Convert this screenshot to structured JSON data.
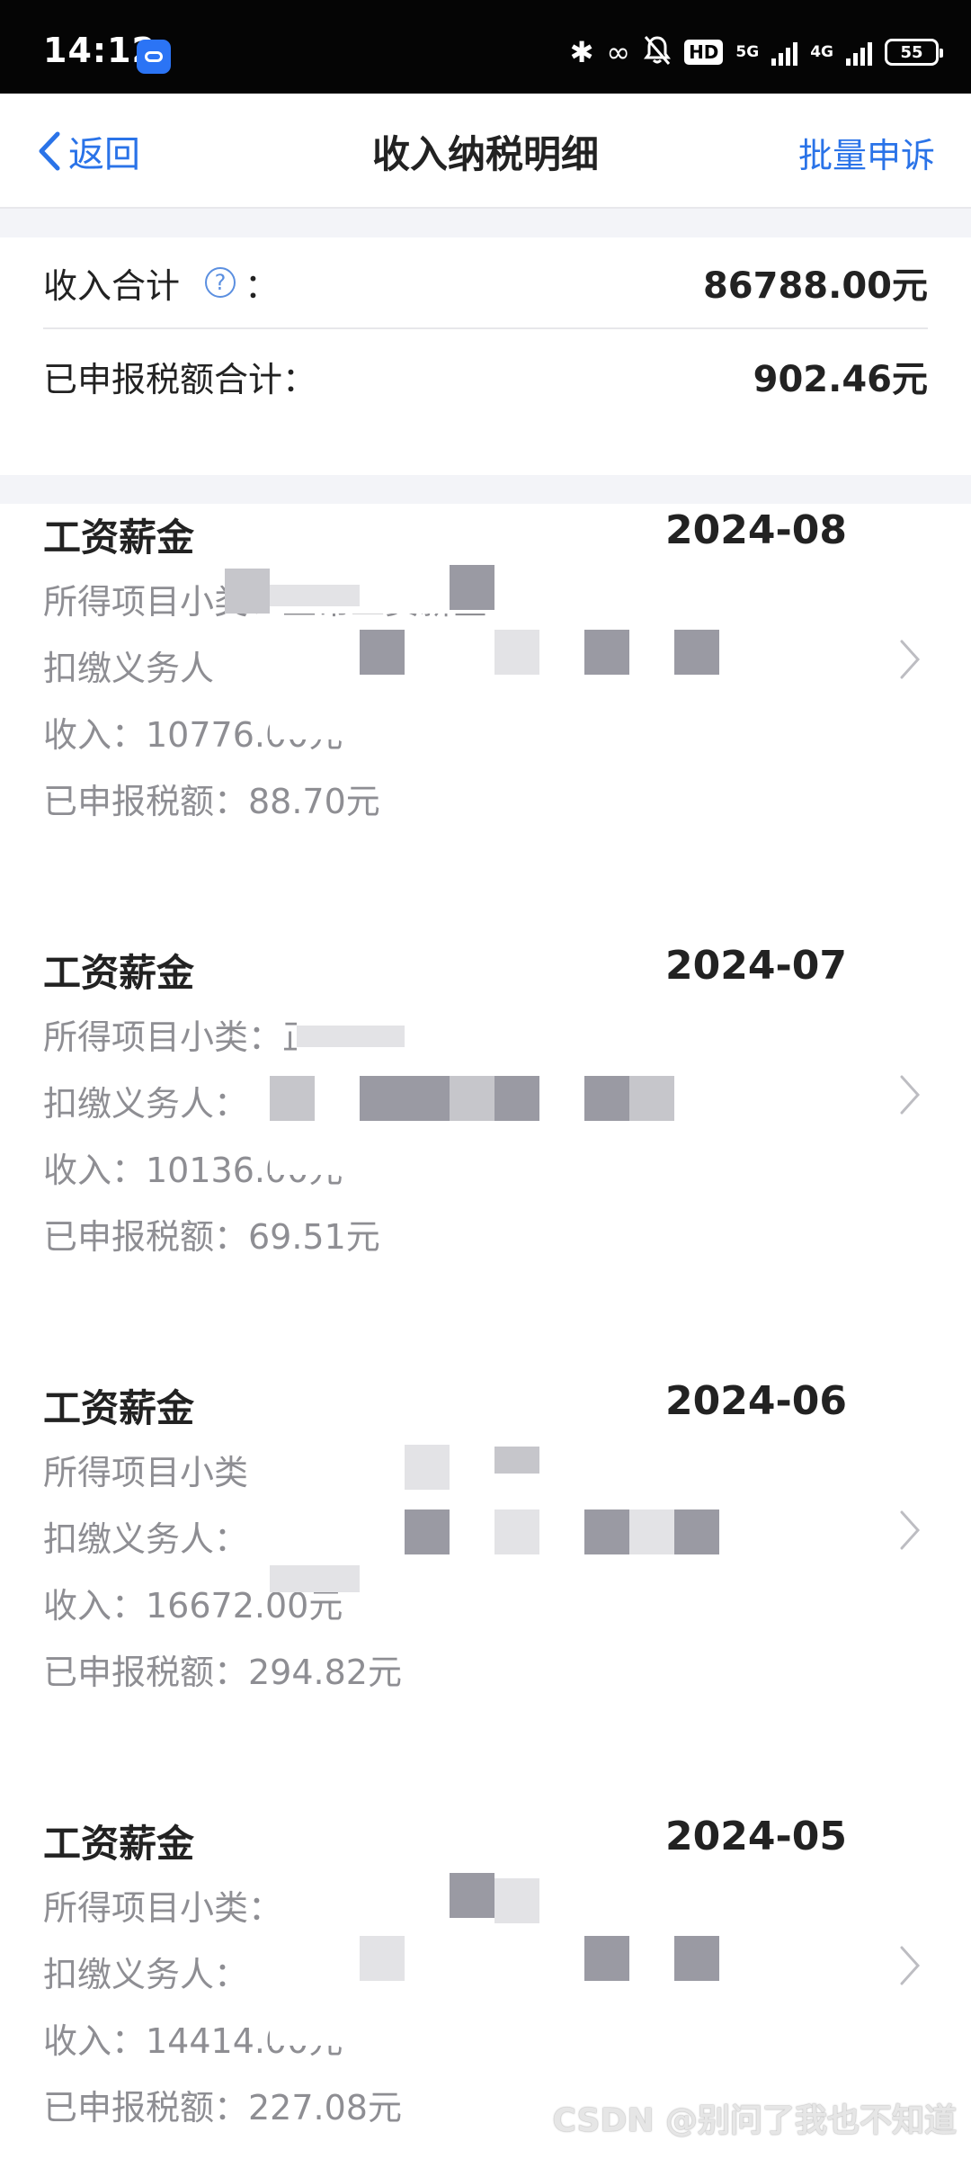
{
  "status_bar": {
    "time": "14:12",
    "hd_label": "HD",
    "network_5g": "5G",
    "network_4g": "4G",
    "battery": "55"
  },
  "nav": {
    "back_label": "返回",
    "title": "收入纳税明细",
    "action_label": "批量申诉"
  },
  "summary": {
    "income_label": "收入合计",
    "income_colon": "：",
    "income_value": "86788.00元",
    "tax_label": "已申报税额合计：",
    "tax_value": "902.46元"
  },
  "records": [
    {
      "title": "工资薪金",
      "date": "2024-08",
      "subcategory": "所得项目小类：正常工资薪金",
      "withholder": "扣缴义务人",
      "income": "收入：10776.00元",
      "tax": "已申报税额：88.70元"
    },
    {
      "title": "工资薪金",
      "date": "2024-07",
      "subcategory": "所得项目小类：正常工资薪金",
      "withholder": "扣缴义务人：",
      "income": "收入：10136.00元",
      "tax": "已申报税额：69.51元"
    },
    {
      "title": "工资薪金",
      "date": "2024-06",
      "subcategory": "所得项目小类",
      "withholder": "扣缴义务人：",
      "income": "收入：16672.00元",
      "tax": "已申报税额：294.82元"
    },
    {
      "title": "工资薪金",
      "date": "2024-05",
      "subcategory": "所得项目小类：",
      "withholder": "扣缴义务人：",
      "income": "收入：14414.00元",
      "tax": "已申报税额：227.08元"
    }
  ],
  "watermark": "CSDN @别问了我也不知道",
  "colors": {
    "accent": "#2a73e8",
    "secondary_text": "#8e8e93",
    "separator_bg": "#f3f4f8"
  },
  "icons": {
    "back": "chevron-left-icon",
    "help": "question-circle-icon",
    "row_arrow": "chevron-right-icon"
  }
}
